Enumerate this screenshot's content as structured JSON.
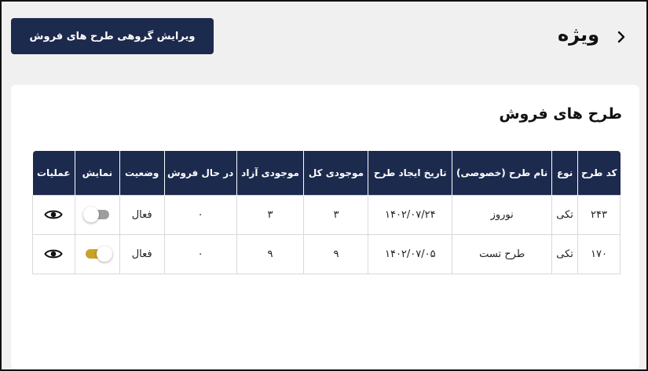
{
  "header": {
    "title": "ویژه",
    "back_icon": "chevron-right-icon",
    "group_edit_label": "ویرایش گروهی طرح های فروش"
  },
  "card": {
    "title": "طرح های فروش"
  },
  "table": {
    "columns": [
      "کد طرح",
      "نوع",
      "نام طرح (خصوصی)",
      "تاریخ ایجاد طرح",
      "موجودی کل",
      "موجودی آزاد",
      "در حال فروش",
      "وضعیت",
      "نمایش",
      "عملیات"
    ],
    "rows": [
      {
        "code": "۲۴۳",
        "type": "تکی",
        "name": "نوروز",
        "created": "۱۴۰۲/۰۷/۲۴",
        "total": "۳",
        "free": "۳",
        "selling": "۰",
        "status": "فعال",
        "display_on": false,
        "action_icon": "eye-icon"
      },
      {
        "code": "۱۷۰",
        "type": "تکی",
        "name": "طرح تست",
        "created": "۱۴۰۲/۰۷/۰۵",
        "total": "۹",
        "free": "۹",
        "selling": "۰",
        "status": "فعال",
        "display_on": true,
        "action_icon": "eye-icon"
      }
    ]
  },
  "colors": {
    "primary": "#1c2a4e",
    "toggle_on": "#c9a227",
    "toggle_off": "#9e9e9e",
    "page_bg": "#f0f0f0",
    "card_bg": "#ffffff",
    "border": "#d9d9d9"
  }
}
